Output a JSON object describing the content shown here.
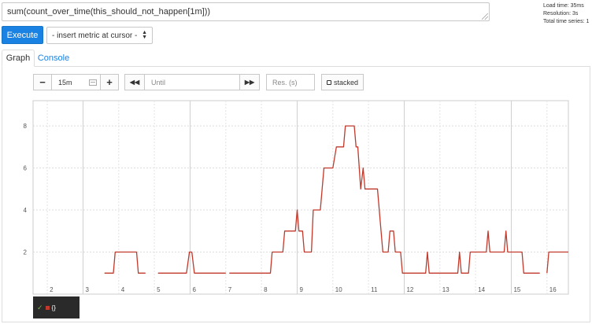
{
  "expression": {
    "value": "sum(count_over_time(this_should_not_happen[1m]))"
  },
  "stats": {
    "load_time": "Load time: 35ms",
    "resolution": "Resolution: 3s",
    "total_series": "Total time series: 1"
  },
  "toolbar": {
    "execute_label": "Execute",
    "metric_select_label": "- insert metric at cursor -"
  },
  "tabs": [
    {
      "label": "Graph",
      "active": true
    },
    {
      "label": "Console",
      "active": false
    }
  ],
  "controls": {
    "minus_label": "−",
    "range_value": "15m",
    "plus_label": "+",
    "back_label": "◀◀",
    "until_placeholder": "Until",
    "forward_label": "▶▶",
    "resolution_placeholder": "Res. (s)",
    "stacked_label": "stacked"
  },
  "colors": {
    "accent": "#1a82e2",
    "series": "#c0392b",
    "legend_bg": "#2a2a2a"
  },
  "chart_data": {
    "type": "line",
    "x_ticks": [
      "2",
      "3",
      "4",
      "5",
      "6",
      "7",
      "8",
      "9",
      "10",
      "11",
      "12",
      "13",
      "14",
      "15",
      "16"
    ],
    "y_ticks": [
      "2",
      "4",
      "6",
      "8"
    ],
    "xlim": [
      1.6,
      16.6
    ],
    "ylim": [
      0,
      9.2
    ],
    "grid": true,
    "series": [
      {
        "color": "#c0392b",
        "segments": [
          [
            [
              3.6,
              1
            ],
            [
              3.85,
              1
            ],
            [
              3.9,
              2
            ],
            [
              4.5,
              2
            ],
            [
              4.55,
              1
            ],
            [
              4.75,
              1
            ]
          ],
          [
            [
              5.1,
              1
            ],
            [
              5.9,
              1
            ],
            [
              5.98,
              2
            ],
            [
              6.05,
              2
            ],
            [
              6.12,
              1
            ],
            [
              7.0,
              1
            ]
          ],
          [
            [
              7.1,
              1
            ],
            [
              8.25,
              1
            ],
            [
              8.3,
              2
            ],
            [
              8.6,
              2
            ],
            [
              8.65,
              3
            ],
            [
              8.95,
              3
            ],
            [
              9.0,
              4
            ],
            [
              9.05,
              3
            ],
            [
              9.15,
              3
            ],
            [
              9.2,
              2
            ],
            [
              9.4,
              2
            ],
            [
              9.45,
              4
            ],
            [
              9.65,
              4
            ],
            [
              9.75,
              6
            ],
            [
              10.0,
              6
            ],
            [
              10.1,
              7
            ],
            [
              10.3,
              7
            ],
            [
              10.35,
              8
            ],
            [
              10.6,
              8
            ],
            [
              10.65,
              7
            ],
            [
              10.7,
              7
            ],
            [
              10.78,
              5
            ],
            [
              10.85,
              6
            ],
            [
              10.9,
              5
            ],
            [
              11.25,
              5
            ],
            [
              11.4,
              2
            ],
            [
              11.55,
              2
            ],
            [
              11.6,
              3
            ],
            [
              11.7,
              3
            ],
            [
              11.75,
              2
            ],
            [
              11.9,
              2
            ],
            [
              11.95,
              1
            ],
            [
              12.6,
              1
            ],
            [
              12.65,
              2
            ],
            [
              12.7,
              1
            ],
            [
              13.5,
              1
            ],
            [
              13.55,
              2
            ],
            [
              13.6,
              1
            ],
            [
              13.8,
              1
            ],
            [
              13.85,
              2
            ],
            [
              14.3,
              2
            ],
            [
              14.35,
              3
            ],
            [
              14.4,
              2
            ],
            [
              14.8,
              2
            ],
            [
              14.85,
              3
            ],
            [
              14.9,
              2
            ],
            [
              15.3,
              2
            ],
            [
              15.35,
              1
            ],
            [
              15.8,
              1
            ]
          ],
          [
            [
              16.0,
              1
            ],
            [
              16.05,
              2
            ],
            [
              16.6,
              2
            ]
          ]
        ]
      }
    ]
  },
  "legend": {
    "check": "✓",
    "label": "{}"
  }
}
